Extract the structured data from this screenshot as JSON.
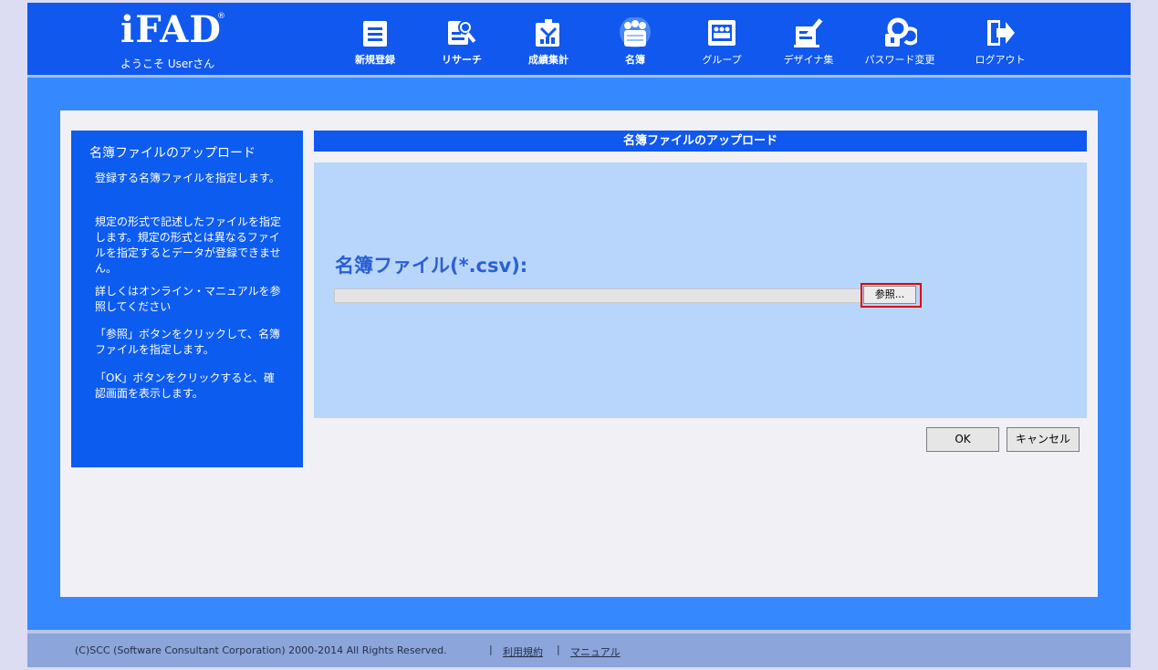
{
  "header": {
    "logo": "iFAD",
    "logo_mark": "®",
    "welcome": "ようこそ Userさん",
    "nav": [
      {
        "label": "新規登録",
        "icon": "new-registration-icon"
      },
      {
        "label": "リサーチ",
        "icon": "research-icon"
      },
      {
        "label": "成績集計",
        "icon": "results-icon"
      },
      {
        "label": "名簿",
        "icon": "roster-icon",
        "active": true
      },
      {
        "label": "グループ",
        "icon": "group-icon"
      },
      {
        "label": "デザイナ集",
        "icon": "designer-icon"
      },
      {
        "label": "パスワード変更",
        "icon": "password-icon"
      },
      {
        "label": "ログアウト",
        "icon": "logout-icon"
      }
    ]
  },
  "sidebar": {
    "title": "名簿ファイルのアップロード",
    "paragraphs": [
      "登録する名簿ファイルを指定します。",
      "規定の形式で記述したファイルを指定します。規定の形式とは異なるファイルを指定するとデータが登録できません。",
      "詳しくはオンライン・マニュアルを参照してください",
      "「参照」ボタンをクリックして、名簿ファイルを指定します。",
      "「OK」ボタンをクリックすると、確認画面を表示します。"
    ]
  },
  "form": {
    "title": "名簿ファイルのアップロード",
    "file_label": "名簿ファイル(*.csv):",
    "file_value": "",
    "browse_label": "参照...",
    "ok_label": "OK",
    "cancel_label": "キャンセル"
  },
  "footer": {
    "copyright": "(C)SCC (Software Consultant Corporation) 2000-2014 All Rights Reserved.",
    "separator": "|",
    "terms_label": "利用規約",
    "manual_label": "マニュアル"
  },
  "colors": {
    "header_bg": "#1058ee",
    "main_bg": "#3588fe",
    "panel_bg": "#b8d5fc",
    "sidebar_bg": "#0d5cf0",
    "highlight": "#e00000",
    "footer_bg": "#8ca5da"
  }
}
